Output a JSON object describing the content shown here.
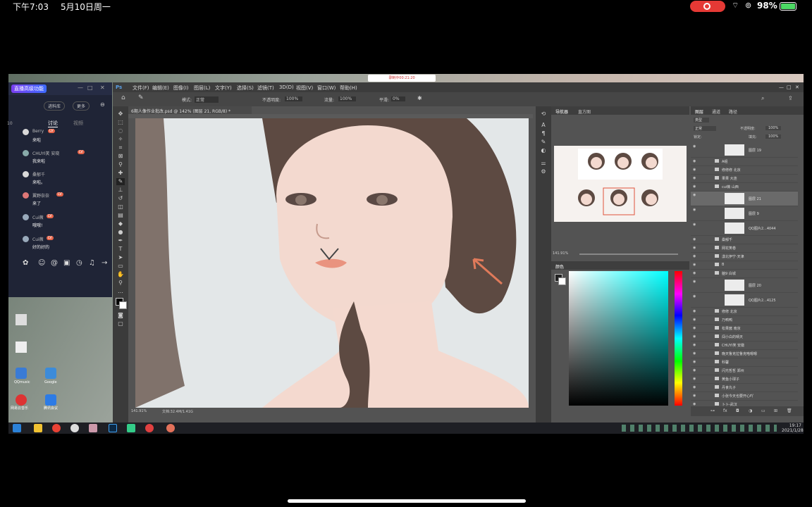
{
  "ios_status": {
    "time": "下午7:03",
    "date": "5月10日周一",
    "battery": "98%"
  },
  "chat": {
    "badge": "直播高级功能",
    "buttons": [
      "进料库",
      "更多"
    ],
    "tabs": [
      "讨论",
      "视频"
    ],
    "messages": [
      {
        "name": "Berry",
        "text": "来啦"
      },
      {
        "name": "CHUYI笑 安晓",
        "text": "我来啦"
      },
      {
        "name": "桑郁千",
        "text": "来啦。"
      },
      {
        "name": "翼野奈奈",
        "text": "来了"
      },
      {
        "name": "Cui薇",
        "text": "哦哦!"
      },
      {
        "name": "Cui薇",
        "text": "好的好的"
      }
    ]
  },
  "recording_chip": "录制中00:21:20",
  "ps": {
    "menu": [
      "文件(F)",
      "编辑(E)",
      "图像(I)",
      "图层(L)",
      "文字(Y)",
      "选择(S)",
      "滤镜(T)",
      "3D(D)",
      "视图(V)",
      "窗口(W)",
      "帮助(H)"
    ],
    "options": {
      "mode_label": "模式:",
      "mode": "正常",
      "opacity_label": "不透明度:",
      "opacity": "100%",
      "flow_label": "流量:",
      "flow": "100%",
      "smooth_label": "平滑:",
      "smooth": "0%"
    },
    "doc_tab": "6期人像作业批改.psd @ 142% (图层 21, RGB/8) *",
    "zoom": "141.91%",
    "doc_size": "文档:32.4M/1.41G",
    "nav_tabs": [
      "导航器",
      "直方图"
    ],
    "nav_zoom": "141.91%",
    "color_tab": "颜色",
    "layer_tabs": [
      "图层",
      "通道",
      "路径"
    ],
    "layer_kind": "类型",
    "blend": "正常",
    "opacity_label": "不透明度:",
    "opacity": "100%",
    "lock_label": "锁定:",
    "fill_label": "填充:",
    "fill": "100%",
    "layers": [
      {
        "name": "图层 19",
        "kind": "layer"
      },
      {
        "name": "A组",
        "kind": "group"
      },
      {
        "name": "修修修 北京",
        "kind": "group"
      },
      {
        "name": "果果 大连",
        "kind": "group"
      },
      {
        "name": "cui薇 山西",
        "kind": "group"
      },
      {
        "name": "图层 21",
        "kind": "layer"
      },
      {
        "name": "图层 9",
        "kind": "layer"
      },
      {
        "name": "QQ图片2...4044",
        "kind": "layer"
      },
      {
        "name": "桑郁千",
        "kind": "group"
      },
      {
        "name": "网花笑卷",
        "kind": "group"
      },
      {
        "name": "漾北伊宁·天津",
        "kind": "group"
      },
      {
        "name": "B",
        "kind": "group"
      },
      {
        "name": "脑9 白城",
        "kind": "group"
      },
      {
        "name": "图层 20",
        "kind": "layer"
      },
      {
        "name": "QQ图片2...4125",
        "kind": "layer"
      },
      {
        "name": "修修 北京",
        "kind": "group"
      },
      {
        "name": "乃鸭鸭",
        "kind": "group"
      },
      {
        "name": "松果酱 南京",
        "kind": "group"
      },
      {
        "name": "闯小白的晴天",
        "kind": "group"
      },
      {
        "name": "CHUYI笑 安徽",
        "kind": "group"
      },
      {
        "name": "晚天鲁克拉鲁克咯嗯嗯",
        "kind": "group"
      },
      {
        "name": "科馨",
        "kind": "group"
      },
      {
        "name": "闪光哲哲 郑州",
        "kind": "group"
      },
      {
        "name": "黄鱼小球子",
        "kind": "group"
      },
      {
        "name": "丹食丸子",
        "kind": "group"
      },
      {
        "name": "小张今天也要开心吖",
        "kind": "group"
      },
      {
        "name": "卜卜-武汉",
        "kind": "group"
      }
    ]
  },
  "taskbar": {
    "time": "19:17",
    "date": "2021/1/28"
  },
  "desktop_icons": [
    "QQmusic",
    "Google",
    "网易云音乐",
    "腾讯会议"
  ]
}
